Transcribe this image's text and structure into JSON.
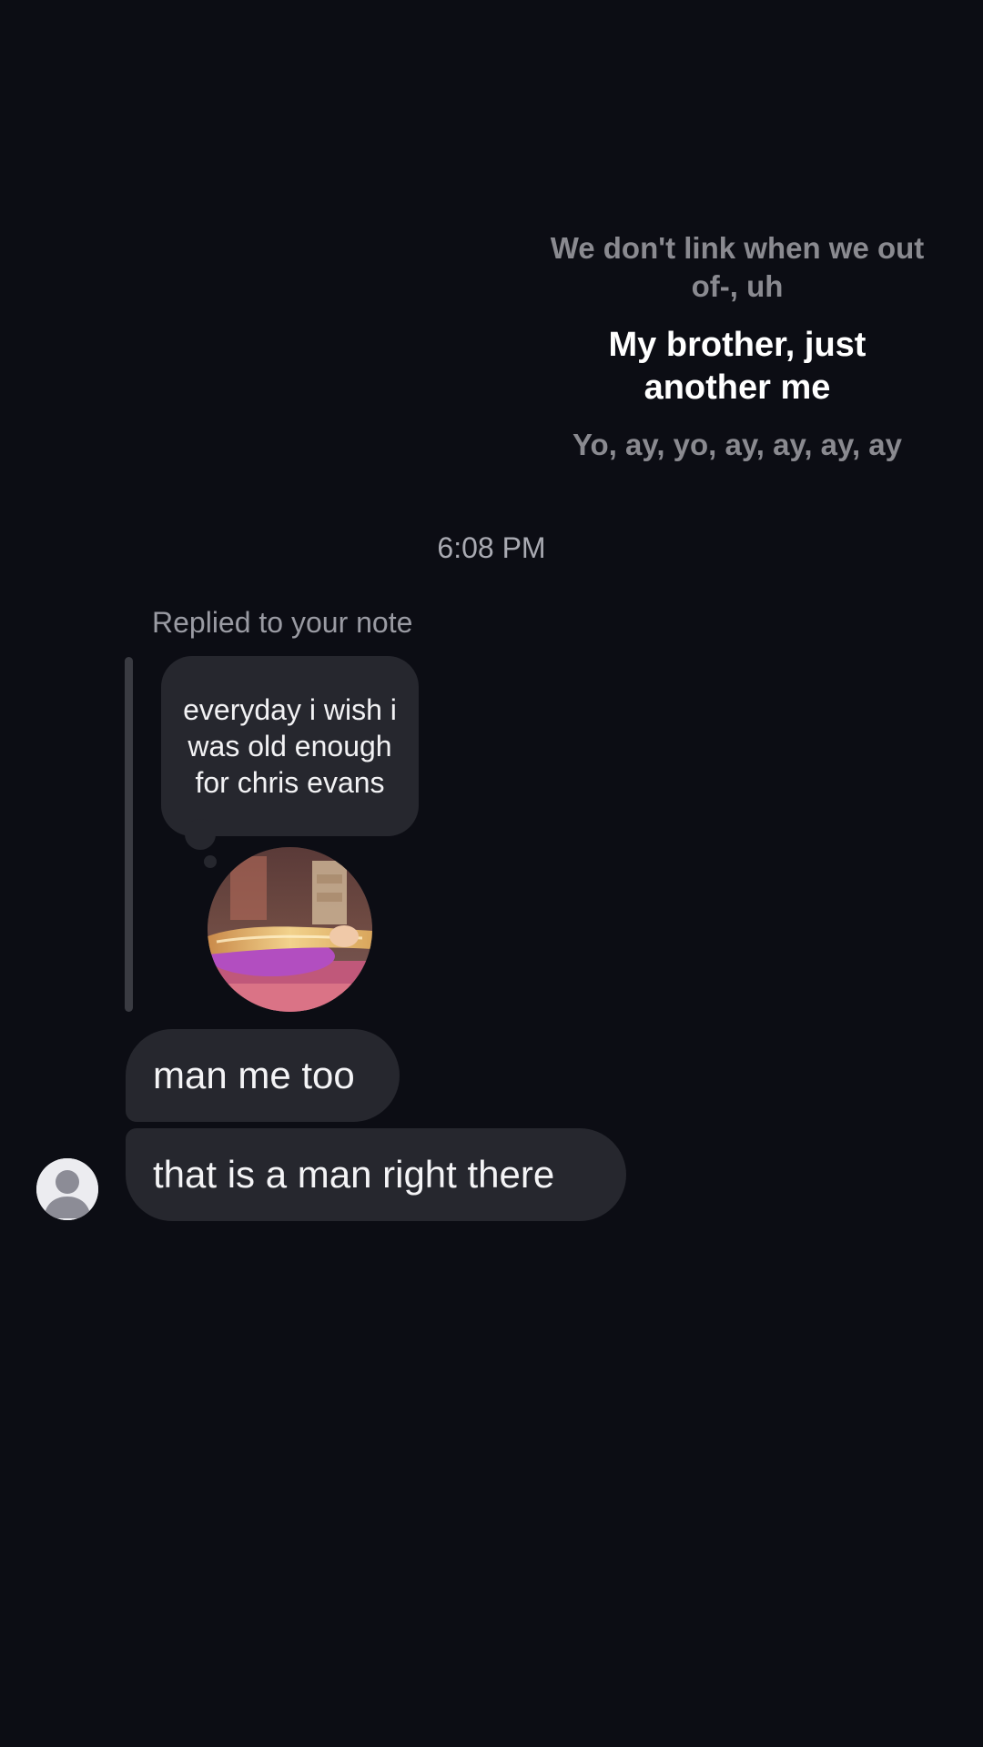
{
  "lyrics": {
    "previous": "We don't link when we out of-, uh",
    "current": "My brother, just another me",
    "next": "Yo, ay, yo, ay, ay, ay, ay"
  },
  "timestamp": "6:08 PM",
  "reply": {
    "label": "Replied to your note",
    "note_text": "everyday i wish i was old enough for chris evans"
  },
  "messages": [
    {
      "text": "man me too"
    },
    {
      "text": "that is a man right there"
    }
  ],
  "icons": {
    "sender_avatar": "default-person-icon",
    "note_avatar": "profile-photo"
  },
  "colors": {
    "background": "#0c0d14",
    "bubble": "#26272e",
    "muted_text": "#9a9ba3",
    "text": "#f4f4f6"
  }
}
